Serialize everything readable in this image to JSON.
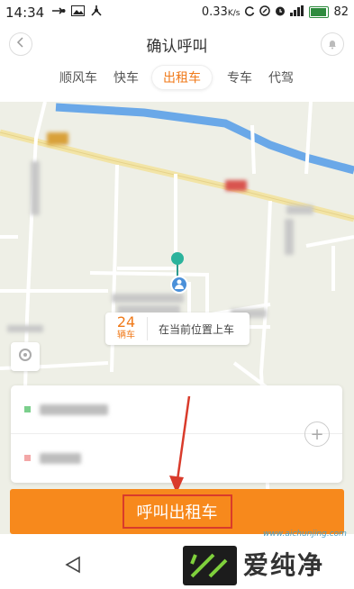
{
  "status_bar": {
    "time": "14:34",
    "data_rate": "0.33",
    "data_unit": "K/s",
    "battery": "82"
  },
  "header": {
    "title": "确认呼叫"
  },
  "tabs": [
    {
      "label": "顺风车",
      "active": false
    },
    {
      "label": "快车",
      "active": false
    },
    {
      "label": "出租车",
      "active": true
    },
    {
      "label": "专车",
      "active": false
    },
    {
      "label": "代驾",
      "active": false
    }
  ],
  "map": {
    "eta_count": "24",
    "eta_unit": "辆车",
    "pickup_hint": "在当前位置上车"
  },
  "call_button": {
    "label": "呼叫出租车"
  },
  "watermark": {
    "brand": "爱纯净",
    "url": "www.aichunjing.com"
  },
  "colors": {
    "accent": "#f7891c",
    "highlight_box": "#d93b2b",
    "river": "#6aa8e8"
  },
  "icons": [
    "back-icon",
    "bell-icon",
    "locate-icon",
    "plus-icon",
    "nav-back-icon"
  ]
}
